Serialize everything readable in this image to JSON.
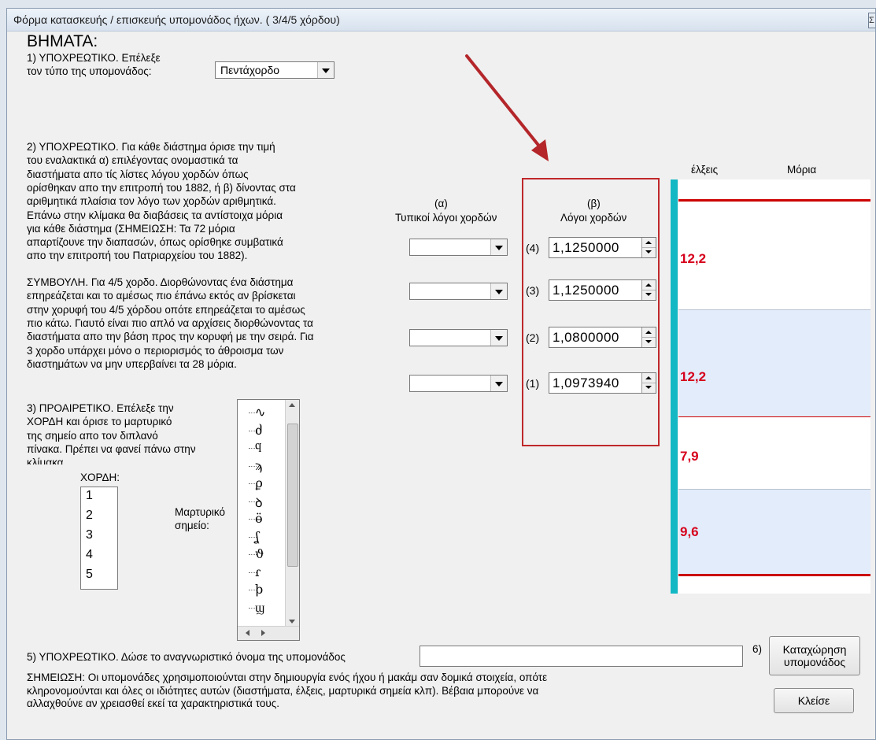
{
  "window": {
    "title": "Φόρμα κατασκευής / επισκευής υπομονάδος ήχων. ( 3/4/5 χόρδου)",
    "close_label": "Σ"
  },
  "header": {
    "steps": "ΒΗΜΑΤΑ:"
  },
  "step1": {
    "line1": "1) ΥΠΟΧΡΕΩΤΙΚΟ.  Επέλεξε",
    "line2": "τον τύπο της υπομονάδος:",
    "combo_value": "Πεντάχορδο"
  },
  "step2": {
    "lines": [
      "2) ΥΠΟΧΡΕΩΤΙΚΟ. Για κάθε διάστημα όρισε την τιμή",
      "του εναλακτικά α) επιλέγοντας ονομαστικά τα",
      "διαστήματα απο τίς λίστες λόγου χορδών όπως",
      "ορίσθηκαν απο την επιτροπή του 1882, ή β) δίνοντας στα",
      "αριθμητικά πλαίσια τον λόγο των χορδών αριθμητικά.",
      "Επάνω στην κλίμακα θα διαβάσεις τα αντίστοιχα μόρια",
      "για κάθε διάστημα (ΣΗΜΕΙΩΣΗ: Τα 72 μόρια",
      "απαρτίζουνε την διαπασών, όπως ορίσθηκε συμβατικά",
      "απο την επιτροπή του Πατριαρχείου του 1882)."
    ]
  },
  "advice": {
    "lines": [
      "ΣΥΜΒΟΥΛΗ. Για 4/5 χορδο. Διορθώνοντας ένα διάστημα",
      "επηρεάζεται και το αμέσως πιο έπάνω εκτός αν βρίσκεται",
      "στην χορυφή του 4/5 χόρδου οπότε επηρεάζεται το αμέσως",
      "πιο κάτω. Γιαυτό είναι πιο απλό να αρχίσεις διορθώνοντας τα",
      "διαστήματα απο την βάση προς την κορυφή με την σειρά. Για",
      "3 χορδο υπάρχει μόνο ο περιορισμός το άθροισμα των",
      "διαστημάτων να μην υπερβαίνει τα 28 μόρια."
    ]
  },
  "col_a": {
    "label": "(α)",
    "title": "Τυπικοί λόγοι χορδών"
  },
  "col_b": {
    "label": "(β)",
    "title": "Λόγοι χορδών"
  },
  "ratios": [
    {
      "index": "(4)",
      "value": "1,1250000"
    },
    {
      "index": "(3)",
      "value": "1,1250000"
    },
    {
      "index": "(2)",
      "value": "1,0800000"
    },
    {
      "index": "(1)",
      "value": "1,0973940"
    }
  ],
  "scale": {
    "header_elxeis": "έλξεις",
    "header_moria": "Μόρια",
    "intervals": [
      "12,2",
      "12,2",
      "7,9",
      "9,6"
    ],
    "colors": {
      "red": "#cc0000",
      "band": "#e2ecfa",
      "cyan": "#14b8c4"
    }
  },
  "step3": {
    "lines": [
      "3) ΠΡΟΑΙΡΕΤΙΚΟ.  Επέλεξε την",
      "ΧΟΡΔΗ και όρισε το μαρτυρικό",
      "της σημείο απο τον διπλανό",
      "πίνακα. Πρέπει να φανεί πάνω στην",
      "κλίμακα"
    ],
    "chord_label": "ΧΟΡΔΗ:",
    "chords": [
      "1",
      "2",
      "3",
      "4",
      "5"
    ],
    "marker_label_1": "Μαρτυρικό",
    "marker_label_2": "σημείο:",
    "glyphs": [
      "∿",
      "ძ",
      "ϥ",
      "ϡ",
      "ϼ",
      "ꝺ",
      "ӫ",
      "ʆ",
      "ϑ",
      "ɾ",
      "ϸ",
      "ϣ"
    ]
  },
  "step5": {
    "label": "5) ΥΠΟΧΡΕΩΤΙΚΟ. Δώσε το αναγνωριστικό όνομα της υπομονάδος",
    "name_value": ""
  },
  "step6": {
    "label": "6)"
  },
  "note": {
    "lines": [
      "ΣΗΜΕΙΩΣΗ: Οι υπομονάδες χρησιμοποιούνται στην δημιουργία ενός ήχου ή μακάμ σαν δομικά στοιχεία, οπότε",
      "κληρονομούνται και όλες οι ιδιότητες αυτών (διαστήματα, έλξεις, μαρτυρικά σημεία κλπ). Βέβαια μπορούνε να",
      "αλλαχθούνε αν χρειασθεί εκεί τα χαρακτηριστικά τους."
    ]
  },
  "buttons": {
    "register_1": "Καταχώρηση",
    "register_2": "υπομονάδος",
    "close": "Κλείσε"
  }
}
